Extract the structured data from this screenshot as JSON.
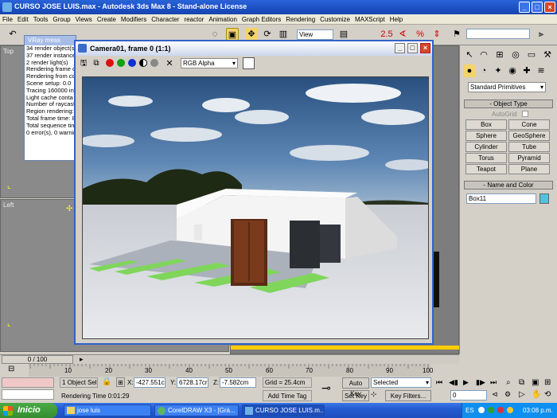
{
  "window": {
    "title": "CURSO JOSE LUIS.max - Autodesk 3ds Max 8 - Stand-alone License"
  },
  "menu": [
    "File",
    "Edit",
    "Tools",
    "Group",
    "Views",
    "Create",
    "Modifiers",
    "Character",
    "reactor",
    "Animation",
    "Graph Editors",
    "Rendering",
    "Customize",
    "MAXScript",
    "Help"
  ],
  "toolbar": {
    "view_dropdown": "View"
  },
  "viewports": {
    "top_label": "Top",
    "left_label": "Left"
  },
  "vray": {
    "title": "VRay mess",
    "lines": [
      "34 render object(s",
      "37 render instance",
      "2 render light(s)",
      "Rendering frame c",
      "Rendering from co",
      "Scene setup: 0.0",
      "Tracing 160000 in",
      "Light cache conta",
      "Number of raycast",
      "Region rendering:",
      "Total frame time: 8",
      "Total sequence tin",
      "0 error(s), 0 warnin"
    ]
  },
  "framebuffer": {
    "title": "Camera01, frame 0 (1:1)",
    "channel": "RGB Alpha"
  },
  "command_panel": {
    "category": "Standard Primitives",
    "object_type_header": "Object Type",
    "autogrid": "AutoGrid",
    "buttons": [
      "Box",
      "Cone",
      "Sphere",
      "GeoSphere",
      "Cylinder",
      "Tube",
      "Torus",
      "Pyramid",
      "Teapot",
      "Plane"
    ],
    "name_color_header": "Name and Color",
    "object_name": "Box11",
    "object_color": "#4fc3e0"
  },
  "timeline": {
    "slider": "0 / 100",
    "ticks": [
      "10",
      "20",
      "30",
      "40",
      "50",
      "60",
      "70",
      "80",
      "90",
      "100"
    ]
  },
  "status": {
    "selection": "1 Object Sele",
    "x": "-427.551cr",
    "y": "6728.17cr",
    "z": "-7.582cm",
    "grid": "Grid = 25.4cm",
    "render_time": "Rendering Time  0:01:29",
    "add_time_tag": "Add Time Tag",
    "auto_key": "Auto Key",
    "set_key": "Set Key",
    "selected": "Selected",
    "key_filters": "Key Filters...",
    "frame": "0"
  },
  "taskbar": {
    "start": "Inicio",
    "tasks": [
      "jose luis",
      "CorelDRAW X3 - [Grá...",
      "CURSO JOSE LUIS.m..."
    ],
    "lang": "ES",
    "clock": "03:08 p.m."
  }
}
